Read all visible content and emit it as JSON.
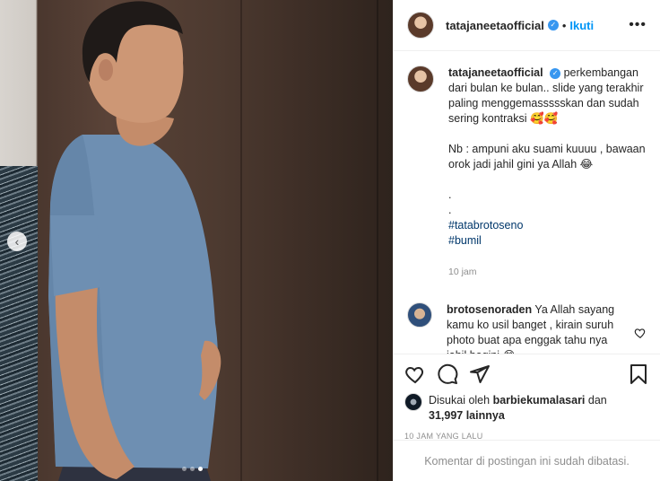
{
  "post": {
    "username": "tatajaneetaofficial",
    "follow_label": "Ikuti",
    "separator": "•",
    "more_icon": "more-horizontal-icon"
  },
  "caption": {
    "username": "tatajaneetaofficial",
    "text": "perkembangan dari bulan ke bulan.. slide yang terakhir paling menggemassssskan dan sudah sering kontraksi 🥰🥰\n\nNb : ampuni aku suami kuuuu , bawaan orok jadi jahil gini ya Allah 😂\n\n.\n.",
    "hashtags": [
      "#tatabrotoseno",
      "#bumil"
    ],
    "time": "10 jam"
  },
  "comment": {
    "username": "brotosenoraden",
    "text": "Ya Allah sayang kamu ko usil banget , kirain suruh photo buat apa enggak tahu nya jahil begini 😂"
  },
  "likes": {
    "prefix": "Disukai oleh",
    "liker": "barbiekumalasari",
    "suffix": "dan",
    "count": "31,997 lainnya"
  },
  "post_time": "10 JAM YANG LALU",
  "comments_limited": "Komentar di postingan ini sudah dibatasi.",
  "carousel": {
    "prev": "‹",
    "slides": 3,
    "active_slide": 3
  },
  "colors": {
    "accent": "#0095f6",
    "verified": "#3897f0",
    "muted": "#8e8e8e",
    "hashtag": "#00376b"
  }
}
